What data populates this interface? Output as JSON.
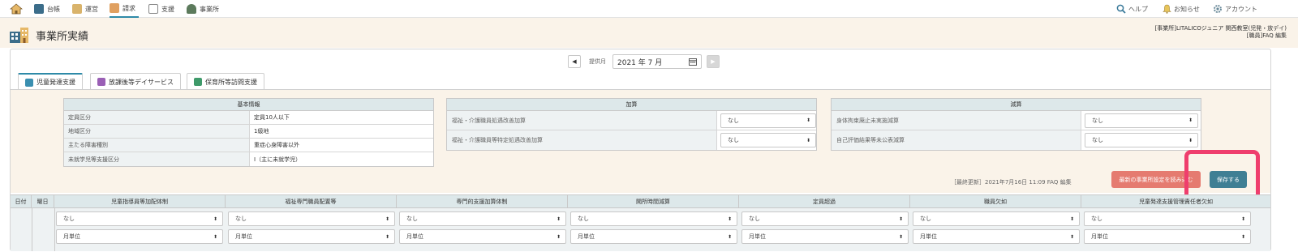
{
  "nav": {
    "items": [
      {
        "label": "台帳",
        "color": "#3b6d8a"
      },
      {
        "label": "運営",
        "color": "#d9b36b"
      },
      {
        "label": "請求",
        "color": "#e0a060"
      },
      {
        "label": "支援",
        "color": "#888888"
      },
      {
        "label": "事業所",
        "color": "#5c7a5c"
      }
    ],
    "help": "ヘルプ",
    "notice": "お知らせ",
    "account": "アカウント"
  },
  "header": {
    "title": "事業所実績",
    "office_line1": "[事業所]LITALICOジュニア 関西教室(児発・放デイ)",
    "office_line2": "[職員]FAQ 編集"
  },
  "month": {
    "label": "提供月",
    "value": "2021 年 7 月"
  },
  "tabs": [
    {
      "label": "児童発達支援",
      "color": "#3a8fb0"
    },
    {
      "label": "放課後等デイサービス",
      "color": "#9a5fb5"
    },
    {
      "label": "保育所等訪問支援",
      "color": "#3f9a6a"
    }
  ],
  "basic_info": {
    "title": "基本情報",
    "rows": [
      {
        "key": "定員区分",
        "value": "定員10人以下"
      },
      {
        "key": "地域区分",
        "value": "1級地"
      },
      {
        "key": "主たる障害種別",
        "value": "重症心身障害以外"
      },
      {
        "key": "未就学児等支援区分",
        "value": "Ⅰ（主に未就学児）"
      }
    ]
  },
  "additions": {
    "title": "加算",
    "rows": [
      {
        "key": "福祉・介護職員処遇改善加算",
        "value": "なし"
      },
      {
        "key": "福祉・介護職員等特定処遇改善加算",
        "value": "なし"
      }
    ]
  },
  "reductions": {
    "title": "減算",
    "rows": [
      {
        "key": "身体拘束廃止未実施減算",
        "value": "なし"
      },
      {
        "key": "自己評価結果等未公表減算",
        "value": "なし"
      }
    ]
  },
  "footer": {
    "last_update": "［最終更新］2021年7月16日 11:09 FAQ 編集",
    "reload_label": "最新の事業所設定を読み込む",
    "save_label": "保存する",
    "highlight_color": "#ef3e6d"
  },
  "table": {
    "headers": [
      "日付",
      "曜日",
      "児童指導員等加配体制",
      "福祉専門職員配置等",
      "専門的支援加算体制",
      "開所時間減算",
      "定員超過",
      "職員欠如",
      "児童発達支援管理責任者欠如"
    ],
    "row1": [
      "なし",
      "なし",
      "なし",
      "なし",
      "なし",
      "なし",
      "なし"
    ],
    "row2": [
      "月単位",
      "月単位",
      "月単位",
      "月単位",
      "月単位",
      "月単位",
      "月単位"
    ]
  }
}
